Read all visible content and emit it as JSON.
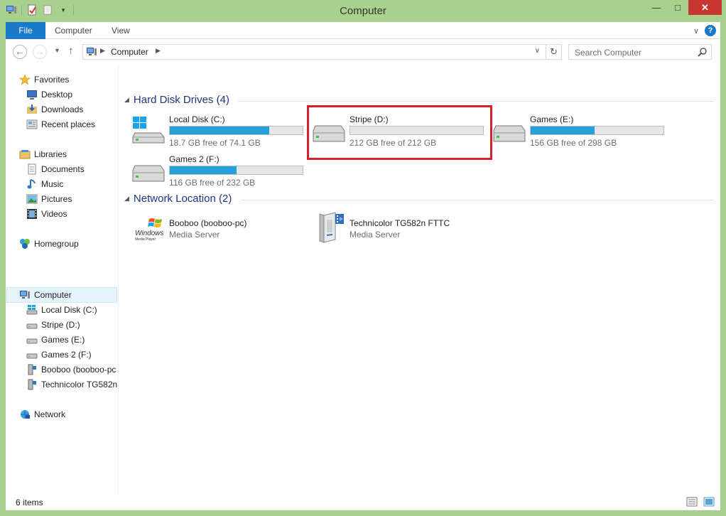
{
  "window": {
    "title": "Computer"
  },
  "ribbon": {
    "file": "File",
    "tabs": [
      "Computer",
      "View"
    ]
  },
  "address": {
    "crumb": "Computer"
  },
  "search": {
    "placeholder": "Search Computer"
  },
  "nav": {
    "favorites": {
      "label": "Favorites",
      "items": [
        "Desktop",
        "Downloads",
        "Recent places"
      ]
    },
    "libraries": {
      "label": "Libraries",
      "items": [
        "Documents",
        "Music",
        "Pictures",
        "Videos"
      ]
    },
    "homegroup": "Homegroup",
    "computer": {
      "label": "Computer",
      "items": [
        "Local Disk (C:)",
        "Stripe (D:)",
        "Games (E:)",
        "Games 2 (F:)",
        "Booboo (booboo-pc",
        "Technicolor TG582n"
      ]
    },
    "network": "Network"
  },
  "groups": {
    "hdd": "Hard Disk Drives (4)",
    "net": "Network Location (2)"
  },
  "drives": [
    {
      "name": "Local Disk (C:)",
      "free": "18.7 GB free of 74.1 GB",
      "used_fraction": 0.75
    },
    {
      "name": "Stripe (D:)",
      "free": "212 GB free of 212 GB",
      "used_fraction": 0.0
    },
    {
      "name": "Games (E:)",
      "free": "156 GB free of 298 GB",
      "used_fraction": 0.48
    },
    {
      "name": "Games 2 (F:)",
      "free": "116 GB free of 232 GB",
      "used_fraction": 0.5
    }
  ],
  "network_items": [
    {
      "name": "Booboo (booboo-pc)",
      "sub": "Media Server",
      "logo_line1": "Windows",
      "logo_line2": "Media Player"
    },
    {
      "name": "Technicolor TG582n FTTC",
      "sub": "Media Server"
    }
  ],
  "status": {
    "count": "6 items"
  },
  "colors": {
    "accent": "#1979ca",
    "bar": "#26a0da",
    "highlight": "#d3222a",
    "frame": "#a9d18e"
  }
}
